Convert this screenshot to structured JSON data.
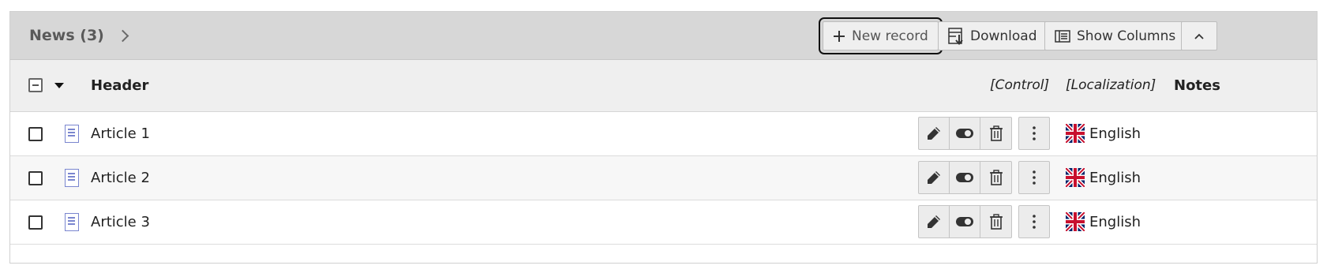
{
  "header": {
    "title": "News (3)",
    "buttons": {
      "new_record": "New record",
      "download": "Download",
      "show_columns": "Show Columns"
    }
  },
  "columns": {
    "header": "Header",
    "control": "[Control]",
    "localization": "[Localization]",
    "notes": "Notes"
  },
  "rows": [
    {
      "title": "Article 1",
      "language": "English"
    },
    {
      "title": "Article 2",
      "language": "English"
    },
    {
      "title": "Article 3",
      "language": "English"
    }
  ],
  "icons": {
    "new_record": "plus-icon",
    "download": "download-icon",
    "show_columns": "columns-icon",
    "collapse": "chevron-up-icon",
    "record": "document-icon",
    "edit": "pencil-icon",
    "toggle": "toggle-icon",
    "delete": "trash-icon",
    "more": "more-vertical-icon",
    "flag": "uk-flag-icon"
  },
  "colors": {
    "header_bg": "#d7d7d7",
    "column_header_bg": "#efefef",
    "doc_icon": "#7a86cf"
  }
}
